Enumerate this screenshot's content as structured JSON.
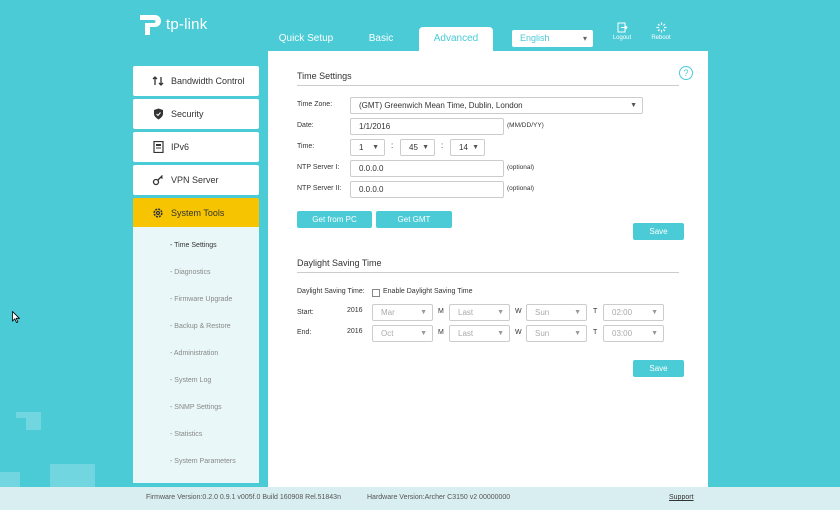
{
  "brand": {
    "name": "tp-link"
  },
  "nav": {
    "tabs": [
      {
        "label": "Quick Setup"
      },
      {
        "label": "Basic"
      },
      {
        "label": "Advanced"
      }
    ],
    "language": "English",
    "logout_label": "Logout",
    "reboot_label": "Reboot"
  },
  "sidebar": {
    "items": [
      {
        "label": "Bandwidth Control"
      },
      {
        "label": "Security"
      },
      {
        "label": "IPv6"
      },
      {
        "label": "VPN Server"
      },
      {
        "label": "System Tools"
      }
    ],
    "sub_items": [
      {
        "label": "- Time Settings"
      },
      {
        "label": "- Diagnostics"
      },
      {
        "label": "- Firmware Upgrade"
      },
      {
        "label": "- Backup & Restore"
      },
      {
        "label": "- Administration"
      },
      {
        "label": "- System Log"
      },
      {
        "label": "- SNMP Settings"
      },
      {
        "label": "- Statistics"
      },
      {
        "label": "- System Parameters"
      }
    ]
  },
  "time_settings": {
    "title": "Time Settings",
    "timezone_label": "Time Zone:",
    "timezone_value": "(GMT) Greenwich Mean Time, Dublin, London",
    "date_label": "Date:",
    "date_value": "1/1/2016",
    "date_hint": "(MM/DD/YY)",
    "time_label": "Time:",
    "hour": "1",
    "minute": "45",
    "second": "14",
    "colon": ":",
    "ntp1_label": "NTP Server I:",
    "ntp1_value": "0.0.0.0",
    "ntp2_label": "NTP Server II:",
    "ntp2_value": "0.0.0.0",
    "optional": "(optional)",
    "get_from_pc": "Get from PC",
    "get_gmt": "Get GMT",
    "save": "Save"
  },
  "dst": {
    "title": "Daylight Saving Time",
    "label": "Daylight Saving Time:",
    "checkbox_label": "Enable Daylight Saving Time",
    "start_label": "Start:",
    "end_label": "End:",
    "start": {
      "year": "2016",
      "month": "Mar",
      "week": "Last",
      "day": "Sun",
      "time": "02:00"
    },
    "end": {
      "year": "2016",
      "month": "Oct",
      "week": "Last",
      "day": "Sun",
      "time": "03:00"
    },
    "m": "M",
    "w": "W",
    "t": "T",
    "save": "Save"
  },
  "footer": {
    "firmware": "Firmware Version:0.2.0 0.9.1 v005f.0 Build 160908 Rel.51843n",
    "hardware": "Hardware Version:Archer C3150 v2 00000000",
    "support": "Support"
  },
  "colors": {
    "accent": "#4acbd6",
    "active_menu": "#f6c400"
  }
}
